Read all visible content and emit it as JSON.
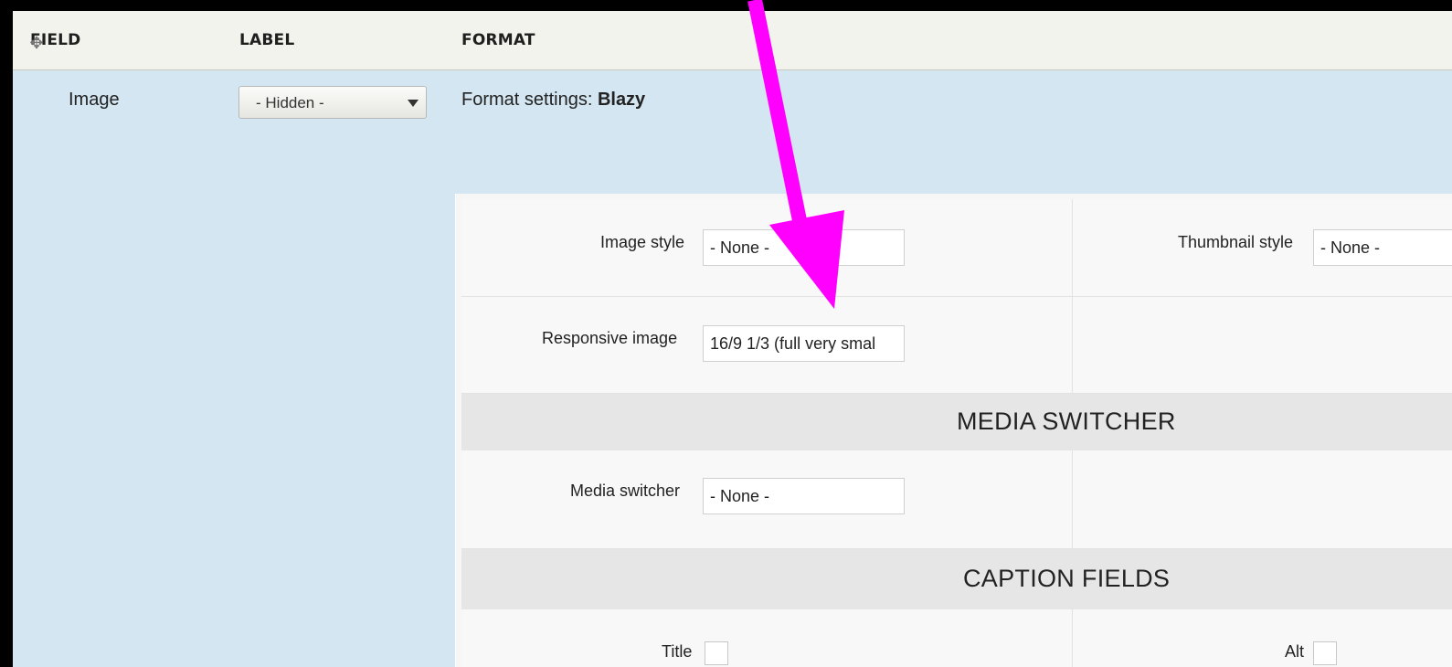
{
  "table": {
    "headers": {
      "field": "FIELD",
      "label": "LABEL",
      "format": "FORMAT"
    },
    "row": {
      "field_name": "Image",
      "label_select": "- Hidden -",
      "format_prefix": "Format settings: ",
      "format_name": "Blazy"
    }
  },
  "settings": {
    "image_style": {
      "label": "Image style",
      "value": "- None -"
    },
    "thumbnail_style": {
      "label": "Thumbnail style",
      "value": "- None -"
    },
    "responsive_image": {
      "label": "Responsive image",
      "value": "16/9 1/3 (full very smal"
    },
    "media_switcher_section": "MEDIA SWITCHER",
    "media_switcher": {
      "label": "Media switcher",
      "value": "- None -"
    },
    "caption_section": "CAPTION FIELDS",
    "caption_title": {
      "label": "Title"
    },
    "caption_alt": {
      "label": "Alt"
    }
  },
  "colors": {
    "row_highlight": "#d4e6f1",
    "annotation_arrow": "#ff00ff"
  },
  "icons": {
    "drag": "move-arrows-icon",
    "select_caret": "caret-down-icon"
  }
}
